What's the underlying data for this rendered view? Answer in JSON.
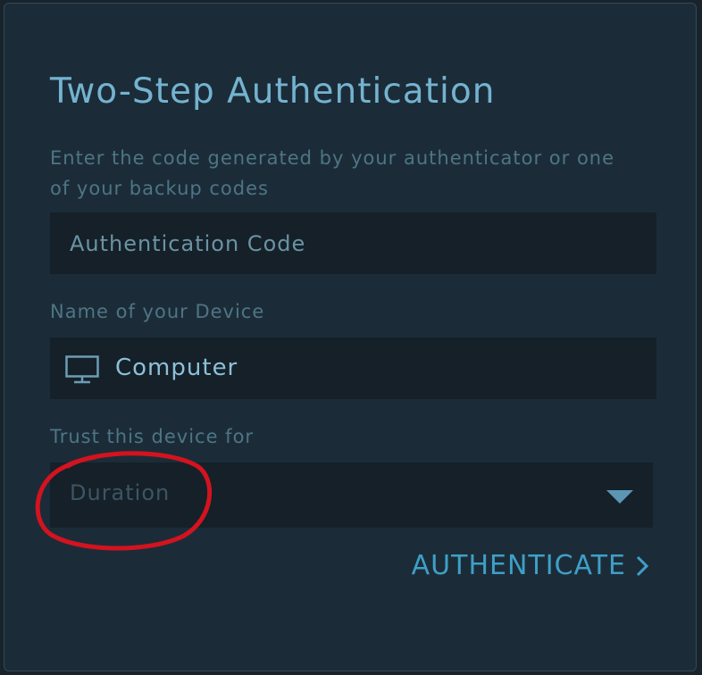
{
  "dialog": {
    "title": "Two-Step Authentication",
    "instruction": "Enter the code generated by your authenticator or one of your backup codes"
  },
  "code_field": {
    "placeholder": "Authentication Code",
    "value": ""
  },
  "device": {
    "label": "Name of your Device",
    "icon": "monitor-icon",
    "value": "Computer"
  },
  "trust": {
    "label": "Trust this device for",
    "value": "Duration",
    "icon": "caret-down-icon"
  },
  "authenticate": {
    "label": "AUTHENTICATE",
    "icon": "chevron-right-icon"
  },
  "annotation": {
    "shape": "hand-drawn ellipse",
    "target": "duration",
    "color": "#d3131f"
  },
  "colors": {
    "panel_background": "#1b2c38",
    "input_background": "#152029",
    "title": "#74b3cf",
    "muted_text": "#4e7584",
    "accent": "#3f9fc8"
  }
}
